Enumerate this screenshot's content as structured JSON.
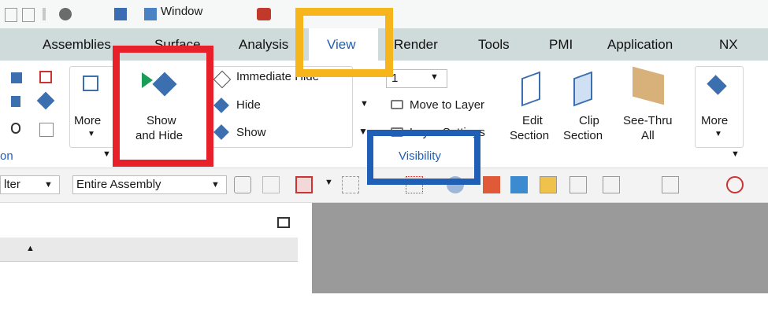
{
  "quick_access": {
    "window_menu": "Window"
  },
  "tabs": [
    {
      "label": "Assemblies"
    },
    {
      "label": "Surface"
    },
    {
      "label": "Analysis"
    },
    {
      "label": "View"
    },
    {
      "label": "Render"
    },
    {
      "label": "Tools"
    },
    {
      "label": "PMI"
    },
    {
      "label": "Application"
    },
    {
      "label": "NX"
    }
  ],
  "ribbon": {
    "left_group_label": "on",
    "more_left": "More",
    "show_and_hide": [
      "Show",
      "and Hide"
    ],
    "immediate_hide": "Immediate Hide",
    "hide": "Hide",
    "show": "Show",
    "layer_value": "1",
    "move_to_layer": "Move to Layer",
    "layer_settings": "Layer Settings",
    "visibility_group": "Visibility",
    "edit_section": [
      "Edit",
      "Section"
    ],
    "clip_section": [
      "Clip",
      "Section"
    ],
    "see_thru": [
      "See-Thru",
      "All"
    ],
    "more_right": "More"
  },
  "filterbar": {
    "filter_value": "lter",
    "scope_value": "Entire Assembly"
  },
  "highlights": {
    "red": "#e8202a",
    "orange": "#f7b51c",
    "blue": "#1f5fb5"
  }
}
